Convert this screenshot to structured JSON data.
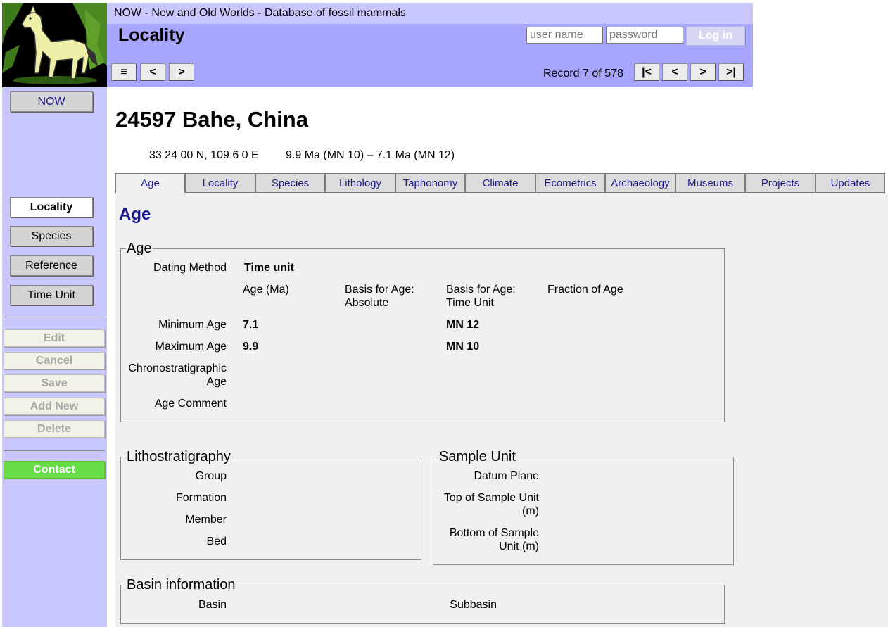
{
  "header": {
    "site_title": "NOW - New and Old Worlds - Database of fossil mammals",
    "page_heading": "Locality",
    "username_placeholder": "user name",
    "password_placeholder": "password",
    "login_label": "Log in",
    "nav_menu": "≡",
    "nav_back": "<",
    "nav_forward": ">",
    "record_count": "Record 7 of 578",
    "rec_first": "|<",
    "rec_prev": "<",
    "rec_next": ">",
    "rec_last": ">|"
  },
  "sidebar": {
    "now_label": "NOW",
    "nav_items": [
      "Locality",
      "Species",
      "Reference",
      "Time Unit"
    ],
    "active_item": "Locality",
    "actions": [
      "Edit",
      "Cancel",
      "Save",
      "Add New",
      "Delete"
    ],
    "contact_label": "Contact"
  },
  "record": {
    "title": "24597 Bahe, China",
    "coordinates": "33 24 00 N, 109 6 0 E",
    "age_range": "9.9 Ma (MN 10) – 7.1 Ma (MN 12)"
  },
  "tabs": [
    "Age",
    "Locality",
    "Species",
    "Lithology",
    "Taphonomy",
    "Climate",
    "Ecometrics",
    "Archaeology",
    "Museums",
    "Projects",
    "Updates"
  ],
  "active_tab": "Age",
  "age_panel": {
    "title": "Age",
    "age_box": {
      "legend": "Age",
      "dating_method_label": "Dating Method",
      "dating_method_value": "Time unit",
      "col_age": "Age (Ma)",
      "col_basis_abs_1": "Basis for Age:",
      "col_basis_abs_2": "Absolute",
      "col_basis_tu_1": "Basis for Age:",
      "col_basis_tu_2": "Time Unit",
      "col_fraction": "Fraction of Age",
      "min_age_label": "Minimum Age",
      "min_age_value": "7.1",
      "min_age_tu": "MN 12",
      "max_age_label": "Maximum Age",
      "max_age_value": "9.9",
      "max_age_tu": "MN 10",
      "chrono_label_1": "Chronostratigraphic",
      "chrono_label_2": "Age",
      "comment_label": "Age Comment"
    },
    "litho_box": {
      "legend": "Lithostratigraphy",
      "group": "Group",
      "formation": "Formation",
      "member": "Member",
      "bed": "Bed"
    },
    "sample_box": {
      "legend": "Sample Unit",
      "datum": "Datum Plane",
      "top_1": "Top of Sample Unit",
      "top_2": "(m)",
      "bottom_1": "Bottom of Sample",
      "bottom_2": "Unit (m)"
    },
    "basin_box": {
      "legend": "Basin information",
      "basin": "Basin",
      "subbasin": "Subbasin"
    }
  },
  "colors": {
    "header_bg": "#a6a6ff",
    "header_strip": "#c8c8ff",
    "sidebar_bg": "#c8c8ff",
    "tab_text": "#1a1a8c",
    "contact_green": "#66dd44",
    "panel_bg": "#f0f0f0"
  }
}
